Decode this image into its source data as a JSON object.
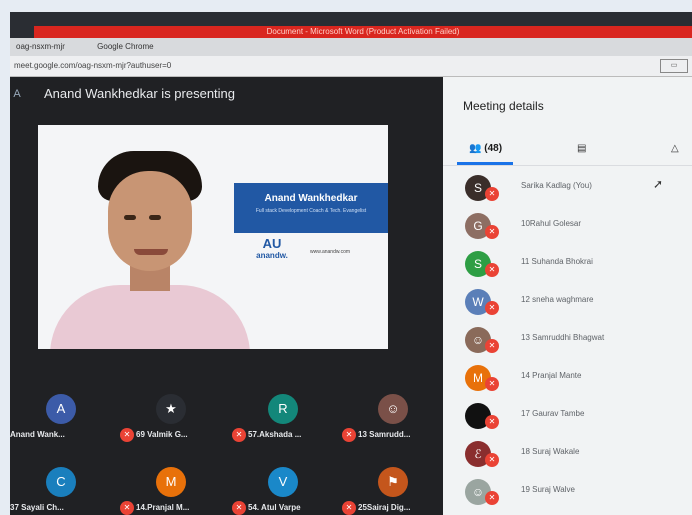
{
  "browser": {
    "warning": "Document - Microsoft Word (Product Activation Failed)",
    "tab_title": "oag-nsxm-mjr",
    "app": "Google Chrome",
    "url": "meet.google.com/oag-nsxm-mjr?authuser=0"
  },
  "stage": {
    "presenter_text": "Anand Wankhedkar is presenting",
    "presenter_initial": "A"
  },
  "slide": {
    "name": "Anand Wankhedkar",
    "role": "Full stack Development Coach & Tech. Evangelist",
    "brand_logo": "AU",
    "brand_name": "anandw.",
    "site": "www.anandw.com"
  },
  "tiles": [
    {
      "initial": "A",
      "name": "Anand Wank...",
      "color": "#3c5ba8"
    },
    {
      "initial": "★",
      "name": "69 Valmik G...",
      "color": "#2a2d33"
    },
    {
      "initial": "R",
      "name": "57.Akshada ...",
      "color": "#13877a"
    },
    {
      "initial": "☺",
      "name": "13 Samrudd...",
      "color": "#7a5048"
    },
    {
      "initial": "C",
      "name": "37 Sayali Ch...",
      "color": "#1a7fbd"
    },
    {
      "initial": "M",
      "name": "14.Pranjal M...",
      "color": "#e8710a"
    },
    {
      "initial": "V",
      "name": "54. Atul Varpe",
      "color": "#1a88c9"
    },
    {
      "initial": "⚑",
      "name": "25Sairaj Dig...",
      "color": "#c4561c"
    }
  ],
  "sidebar": {
    "title": "Meeting details",
    "people_count": "(48)",
    "participants": [
      {
        "initial": "S",
        "name": "Sarika Kadlag (You)",
        "color": "#3a2e2a"
      },
      {
        "initial": "G",
        "name": "10Rahul Golesar",
        "color": "#8d6e63"
      },
      {
        "initial": "S",
        "name": "11 Suhanda Bhokrai",
        "color": "#2e9e44"
      },
      {
        "initial": "W",
        "name": "12 sneha waghmare",
        "color": "#5b7fb8"
      },
      {
        "initial": "☺",
        "name": "13 Samruddhi Bhagwat",
        "color": "#8a6a5a"
      },
      {
        "initial": "M",
        "name": "14 Pranjal Mante",
        "color": "#e8710a"
      },
      {
        "initial": "",
        "name": "17 Gaurav Tambe",
        "color": "#111111"
      },
      {
        "initial": "ℰ",
        "name": "18 Suraj Wakale",
        "color": "#8a2e2e"
      },
      {
        "initial": "☺",
        "name": "19 Suraj Walve",
        "color": "#9aa5a0"
      }
    ]
  }
}
